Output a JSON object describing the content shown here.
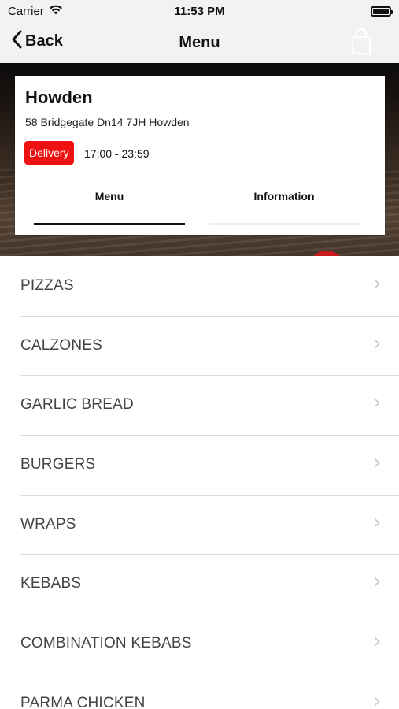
{
  "status_bar": {
    "carrier": "Carrier",
    "time": "11:53 PM"
  },
  "nav": {
    "back_label": "Back",
    "title": "Menu",
    "bag_icon": "shopping-bag-icon"
  },
  "restaurant": {
    "name": "Howden",
    "address": "58 Bridgegate Dn14 7JH Howden",
    "badge": "Delivery",
    "hours": "17:00 - 23:59"
  },
  "tabs": [
    {
      "label": "Menu",
      "active": true
    },
    {
      "label": "Information",
      "active": false
    }
  ],
  "menu_items": [
    {
      "label": "PIZZAS"
    },
    {
      "label": "CALZONES"
    },
    {
      "label": "GARLIC BREAD"
    },
    {
      "label": "BURGERS"
    },
    {
      "label": "WRAPS"
    },
    {
      "label": "KEBABS"
    },
    {
      "label": "COMBINATION KEBABS"
    },
    {
      "label": "PARMA CHICKEN"
    }
  ],
  "colors": {
    "accent_red": "#ee1111",
    "nav_background": "#f2f2f2",
    "divider": "#dcdcdc"
  }
}
